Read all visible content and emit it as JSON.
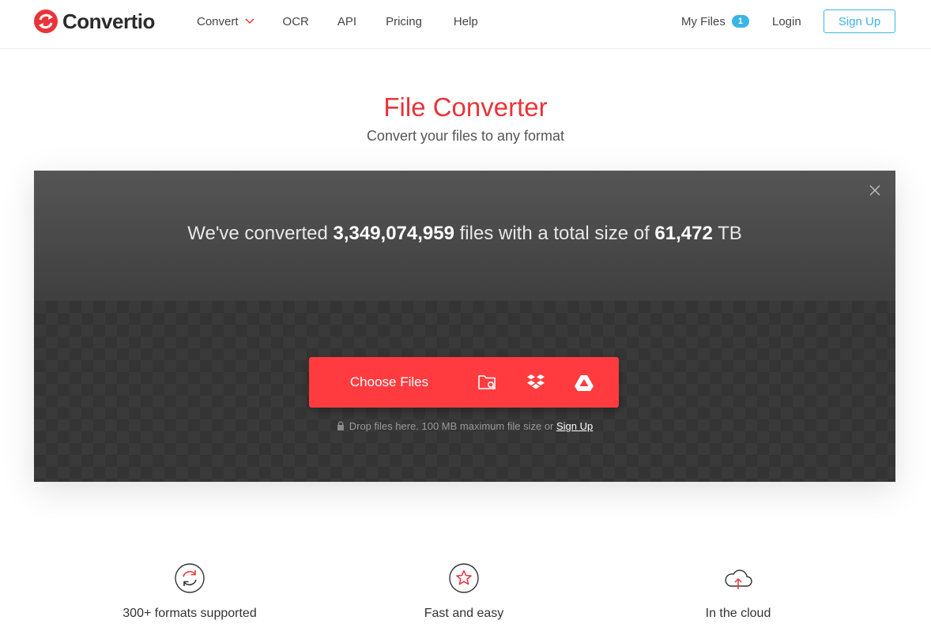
{
  "colors": {
    "accent_red": "#e8343a",
    "button_red": "#ff3b3f",
    "link_blue": "#3bb5e8",
    "box_dark": "#3a3a3a"
  },
  "header": {
    "logo_text": "Convertio",
    "nav": {
      "convert": "Convert",
      "ocr": "OCR",
      "api": "API",
      "pricing": "Pricing",
      "help": "Help"
    },
    "my_files": "My Files",
    "my_files_count": "1",
    "login": "Login",
    "signup": "Sign Up"
  },
  "hero": {
    "title": "File Converter",
    "subtitle": "Convert your files to any format"
  },
  "converter": {
    "stats_prefix": "We've converted ",
    "files_count": "3,349,074,959",
    "stats_middle": " files with a total size of ",
    "total_size": "61,472",
    "stats_suffix": " TB",
    "choose_files": "Choose Files",
    "sources": [
      "computer-icon",
      "dropbox-icon",
      "google-drive-icon"
    ],
    "drop_note": "Drop files here. 100 MB maximum file size or ",
    "drop_signup": "Sign Up"
  },
  "features": [
    {
      "icon": "refresh-icon",
      "label": "300+ formats supported"
    },
    {
      "icon": "star-icon",
      "label": "Fast and easy"
    },
    {
      "icon": "cloud-upload-icon",
      "label": "In the cloud"
    }
  ]
}
